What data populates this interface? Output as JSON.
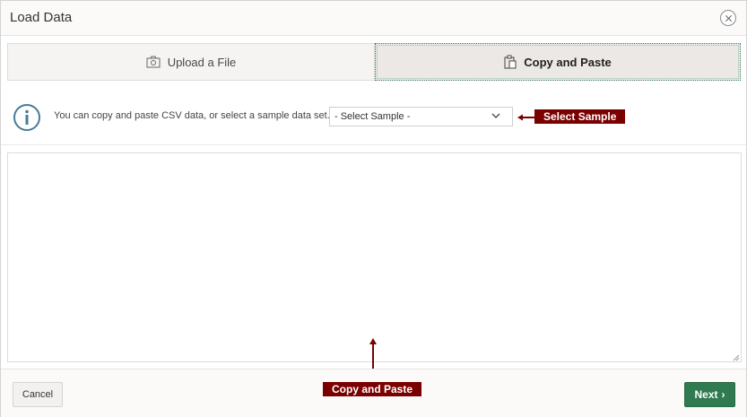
{
  "dialog": {
    "title": "Load Data",
    "close_icon": "close-icon"
  },
  "tabs": [
    {
      "label": "Upload a File",
      "icon": "upload-file-icon",
      "selected": false
    },
    {
      "label": "Copy and Paste",
      "icon": "clipboard-icon",
      "selected": true
    }
  ],
  "info": {
    "icon": "info-icon",
    "text": "You can copy and paste CSV data, or select a sample data set."
  },
  "sample_select": {
    "value": "- Select Sample -",
    "icon": "chevron-down-icon"
  },
  "paste_area": {
    "value": ""
  },
  "annotations": {
    "select_sample": "Select Sample",
    "copy_and_paste": "Copy and Paste",
    "color": "#7a0000"
  },
  "footer": {
    "cancel_label": "Cancel",
    "next_label": "Next",
    "next_icon": "chevron-right-icon"
  },
  "colors": {
    "primary_button": "#2f7a50",
    "active_tab_border": "#3d7a5c",
    "info_icon": "#4a7a99"
  }
}
